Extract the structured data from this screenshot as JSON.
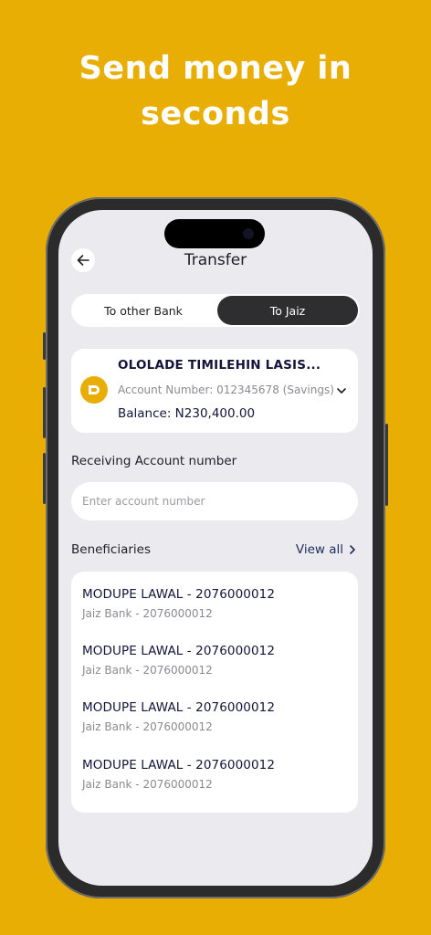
{
  "headline": {
    "line1": "Send money in",
    "line2": "seconds"
  },
  "header": {
    "title": "Transfer",
    "back_icon": "arrow-left-icon"
  },
  "tabs": {
    "other_bank": "To other Bank",
    "jaiz": "To Jaiz",
    "active": "To Jaiz"
  },
  "account": {
    "name": "OLOLADE TIMILEHIN LASIS...",
    "number": "Account Number: 012345678 (Savings)",
    "balance": "Balance: N230,400.00",
    "logo_icon": "jaiz-logo-icon",
    "dropdown_icon": "chevron-down-icon"
  },
  "receiving": {
    "label": "Receiving Account number",
    "placeholder": "Enter account number",
    "value": ""
  },
  "beneficiaries": {
    "label": "Beneficiaries",
    "view_all": "View all",
    "view_all_icon": "chevron-right-icon",
    "items": [
      {
        "name": "MODUPE LAWAL - 2076000012",
        "bank": "Jaiz Bank - 2076000012"
      },
      {
        "name": "MODUPE LAWAL - 2076000012",
        "bank": "Jaiz Bank - 2076000012"
      },
      {
        "name": "MODUPE LAWAL - 2076000012",
        "bank": "Jaiz Bank - 2076000012"
      },
      {
        "name": "MODUPE LAWAL - 2076000012",
        "bank": "Jaiz Bank - 2076000012"
      }
    ]
  },
  "colors": {
    "background": "#E9AE03",
    "accent": "#E9AE03",
    "active_tab": "#2E2E30",
    "screen": "#EBEBEF"
  }
}
